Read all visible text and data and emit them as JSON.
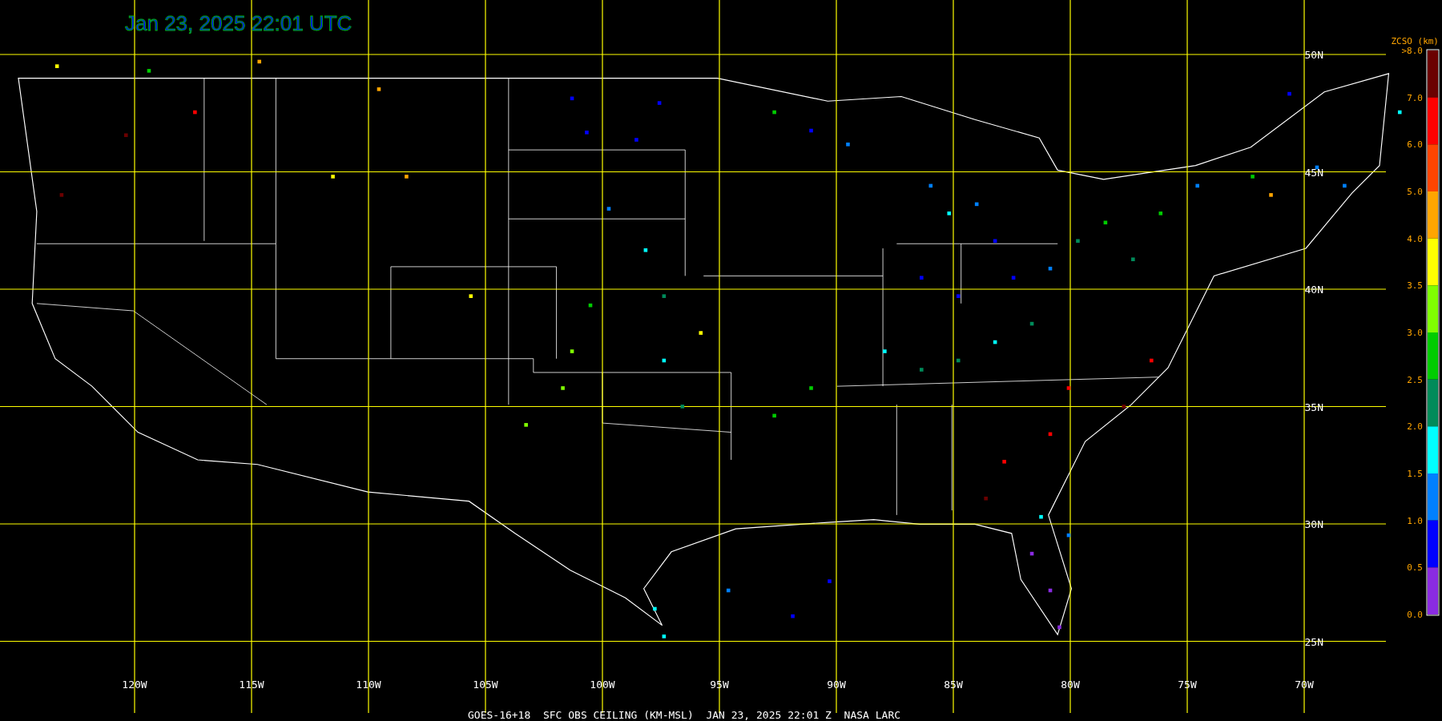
{
  "title": "Jan 23, 2025 22:01 UTC",
  "latitude_labels": [
    "50N",
    "45N",
    "40N",
    "35N",
    "30N",
    "25N"
  ],
  "longitude_labels": [
    "120W",
    "115W",
    "110W",
    "105W",
    "100W",
    "95W",
    "90W",
    "85W",
    "80W",
    "75W",
    "70W"
  ],
  "legend": {
    "title": "ZCSO (km)",
    "labels": [
      ">8.0",
      "7.0",
      "6.0",
      "5.0",
      "4.0",
      "3.5",
      "3.0",
      "2.5",
      "2.0",
      "1.5",
      "1.0",
      "0.5",
      "0.0"
    ],
    "segments": [
      {
        "color": "#6b0000"
      },
      {
        "color": "#ff0000"
      },
      {
        "color": "#ff4500"
      },
      {
        "color": "#ffa500"
      },
      {
        "color": "#ffff00"
      },
      {
        "color": "#80ff00"
      },
      {
        "color": "#00cc00"
      },
      {
        "color": "#008b5a"
      },
      {
        "color": "#00ffff"
      },
      {
        "color": "#0080ff"
      },
      {
        "color": "#0000ff"
      },
      {
        "color": "#8a2be2"
      }
    ]
  },
  "caption": "GOES-16+18  SFC OBS CEILING (KM-MSL)  JAN 23, 2025 22:01 Z  NASA LARC"
}
